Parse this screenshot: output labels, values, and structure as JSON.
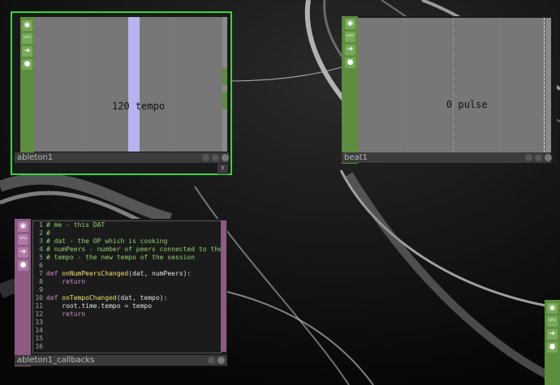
{
  "nodes": {
    "ableton": {
      "name": "ableton1",
      "value": "120",
      "channel": "tempo",
      "accent": "#39d63a"
    },
    "beat": {
      "name": "beat1",
      "value": "0",
      "channel": "pulse"
    },
    "callbacks": {
      "name": "ableton1_callbacks",
      "lines": [
        {
          "num": "1",
          "text": "# me - this DAT",
          "type": "comment"
        },
        {
          "num": "2",
          "text": "#",
          "type": "comment"
        },
        {
          "num": "3",
          "text": "# dat - the OP which is cooking",
          "type": "comment"
        },
        {
          "num": "4",
          "text": "# numPeers - number of peers connected to the s",
          "type": "comment"
        },
        {
          "num": "5",
          "text": "# tempo - the new tempo of the session",
          "type": "comment"
        },
        {
          "num": "6",
          "text": "",
          "type": "plain"
        },
        {
          "num": "7",
          "kw": "def ",
          "fn": "onNumPeersChanged",
          "rest": "(dat, numPeers):",
          "type": "def"
        },
        {
          "num": "8",
          "text": "    return",
          "type": "keyword"
        },
        {
          "num": "9",
          "text": "",
          "type": "plain"
        },
        {
          "num": "10",
          "kw": "def ",
          "fn": "onTempoChanged",
          "rest": "(dat, tempo):",
          "type": "def"
        },
        {
          "num": "11",
          "text": "    root.time.tempo = tempo",
          "type": "plain"
        },
        {
          "num": "12",
          "text": "    return",
          "type": "keyword"
        },
        {
          "num": "13",
          "text": "",
          "type": "plain"
        },
        {
          "num": "14",
          "text": "",
          "type": "plain"
        },
        {
          "num": "15",
          "text": "",
          "type": "plain"
        },
        {
          "num": "16",
          "text": "",
          "type": "plain"
        }
      ]
    }
  },
  "colors": {
    "chop_strip": "#5d8d3e",
    "dat_strip": "#8e5b85",
    "selected_border": "#39d63a",
    "bar_fill": "#b5b4ee"
  },
  "icons": [
    "viewer-toggle-icon",
    "bypass-icon",
    "cook-icon",
    "lock-icon"
  ]
}
